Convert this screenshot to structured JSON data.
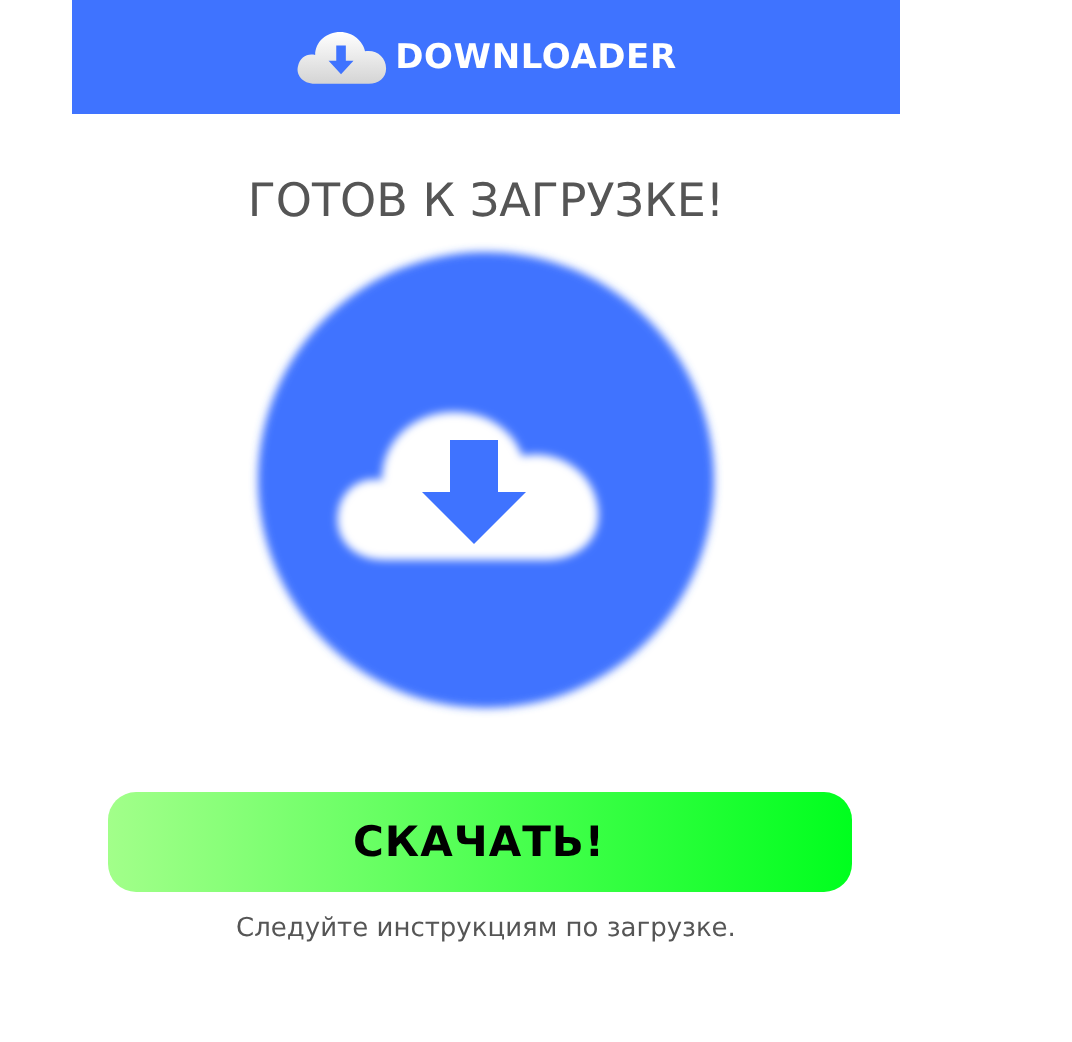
{
  "header": {
    "logo_text": "DOWNLOADER"
  },
  "title": "ГОТОВ К ЗАГРУЗКЕ!",
  "download_button": {
    "label": "СКАЧАТЬ!"
  },
  "note": "Следуйте инструкциям по загрузке."
}
